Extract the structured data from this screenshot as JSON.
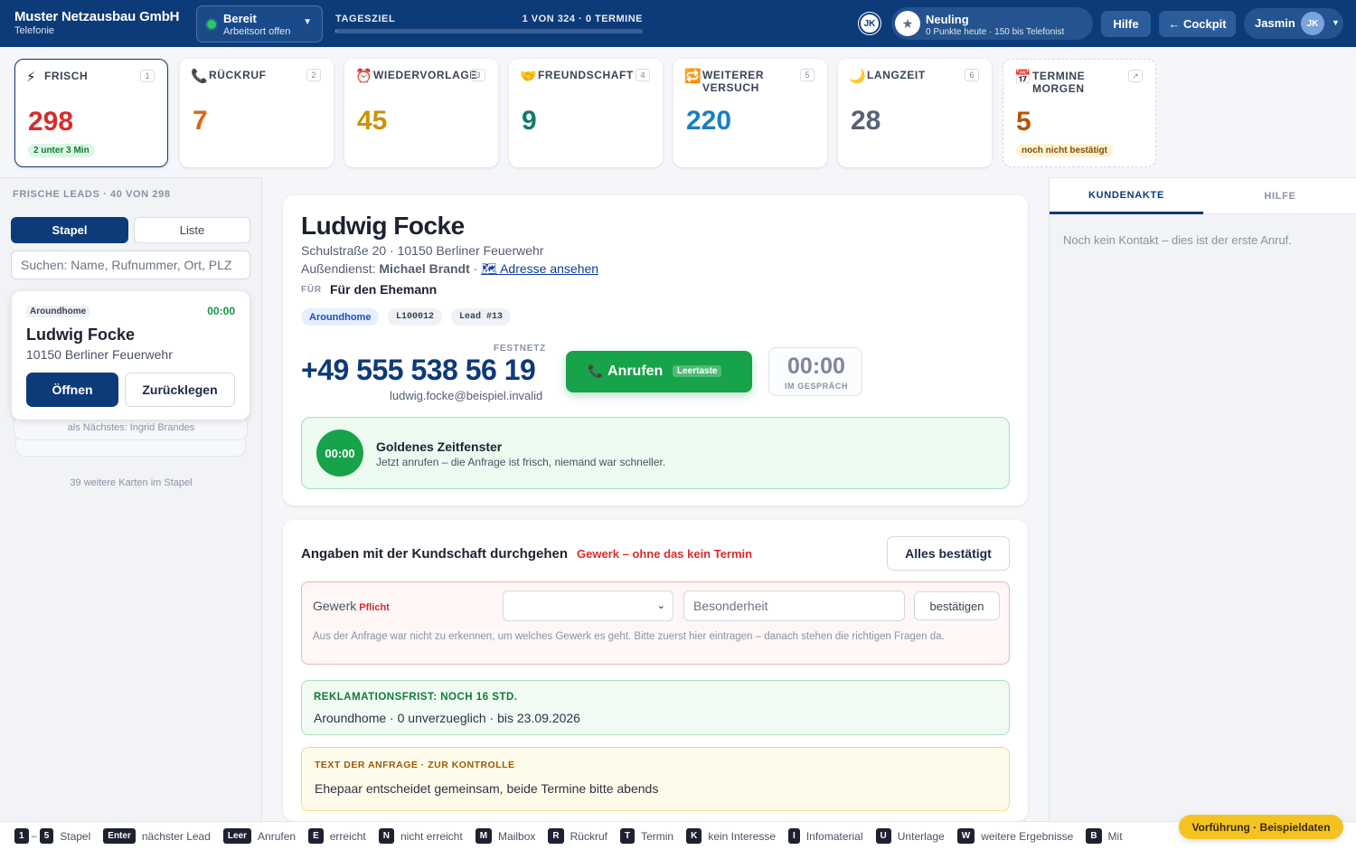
{
  "header": {
    "company": "Muster Netzausbau GmbH",
    "app": "Telefonie",
    "status": {
      "label": "Bereit",
      "sub": "Arbeitsort offen",
      "color": "#2ec46a"
    },
    "goal": {
      "label": "TAGESZIEL",
      "count": "1 VON 324 · 0 TERMINE",
      "progress": 0.003
    },
    "initials_badge": "JK",
    "level": {
      "name": "Neuling",
      "sub": "0 Punkte heute · 150 bis Telefonist"
    },
    "help_label": "Hilfe",
    "cockpit_label": "← Cockpit",
    "user": {
      "name": "Jasmin",
      "initials": "JK"
    }
  },
  "stacks": [
    {
      "icon": "lightning-icon",
      "glyph": "⚡",
      "title": "FRISCH",
      "key": "1",
      "count": "298",
      "color": "#d92c2c",
      "badge": "2 unter 3 Min"
    },
    {
      "icon": "phone-icon",
      "glyph": "📞",
      "title": "RÜCKRUF",
      "key": "2",
      "count": "7",
      "color": "#e0620e"
    },
    {
      "icon": "alarm-clock-icon",
      "glyph": "⏰",
      "title": "WIEDERVORLAGE",
      "key": "3",
      "count": "45",
      "color": "#c9920a"
    },
    {
      "icon": "handshake-icon",
      "glyph": "🤝",
      "title": "FREUNDSCHAFT",
      "key": "4",
      "count": "9",
      "color": "#137a6a"
    },
    {
      "icon": "repeat-icon",
      "glyph": "🔁",
      "title": "WEITERER VERSUCH",
      "key": "5",
      "count": "220",
      "color": "#1a7fc2"
    },
    {
      "icon": "moon-icon",
      "glyph": "🌙",
      "title": "LANGZEIT",
      "key": "6",
      "count": "28",
      "color": "#566275"
    },
    {
      "icon": "calendar-icon",
      "glyph": "📅",
      "title": "TERMINE MORGEN",
      "key": "↗",
      "count": "5",
      "color": "#b45309",
      "badge": "noch nicht bestätigt"
    }
  ],
  "left": {
    "header": "FRISCHE LEADS · 40 VON 298",
    "tab_stapel": "Stapel",
    "tab_liste": "Liste",
    "search_placeholder": "Suchen: Name, Rufnummer, Ort, PLZ",
    "card": {
      "source": "Aroundhome",
      "timer": "00:00",
      "name": "Ludwig Focke",
      "city": "10150 Berliner Feuerwehr",
      "open_label": "Öffnen",
      "back_label": "Zurücklegen"
    },
    "next_label": "als Nächstes: Ingrid Brandes",
    "more_label": "39 weitere Karten im Stapel"
  },
  "customer": {
    "name": "Ludwig Focke",
    "address": "Schulstraße 20 · 10150 Berliner Feuerwehr",
    "ad_prefix": "Außendienst: ",
    "ad_name": "Michael Brandt",
    "ad_sep": " · ",
    "address_link": "🗺 Adresse ansehen",
    "fuer_label": "FÜR",
    "fuer_value": "Für den Ehemann",
    "tags": [
      "Aroundhome",
      "L100012",
      "Lead #13"
    ],
    "phone_type": "FESTNETZ",
    "phone": "+49 555 538 56 19",
    "email": "ludwig.focke@beispiel.invalid",
    "call_label": "Anrufen",
    "call_key": "Leertaste",
    "call_timer": "00:00",
    "call_timer_label": "IM GESPRÄCH",
    "golden": {
      "timer": "00:00",
      "title": "Goldenes Zeitfenster",
      "text": "Jetzt anrufen – die Anfrage ist frisch, niemand war schneller."
    }
  },
  "details": {
    "title": "Angaben mit der Kundschaft durchgehen",
    "warning": "Gewerk – ohne das kein Termin",
    "confirm_all": "Alles bestätigt",
    "gewerk_label": "Gewerk",
    "gewerk_required": "Pflicht",
    "gewerk_selected": "",
    "special_placeholder": "Besonderheit",
    "confirm_label": "bestätigen",
    "gewerk_hint": "Aus der Anfrage war nicht zu erkennen, um welches Gewerk es geht. Bitte zuerst hier eintragen – danach stehen die richtigen Fragen da.",
    "complaint_title": "REKLAMATIONSFRIST: NOCH 16 STD.",
    "complaint_text": "Aroundhome · 0 unverzueglich · bis 23.09.2026",
    "request_title": "TEXT DER ANFRAGE · ZUR KONTROLLE",
    "request_text": "Ehepaar entscheidet gemeinsam, beide Termine bitte abends"
  },
  "right": {
    "tab_kundenakte": "KUNDENAKTE",
    "tab_hilfe": "HILFE",
    "empty_text": "Noch kein Kontakt – dies ist der erste Anruf."
  },
  "shortcuts": {
    "range_from": "1",
    "range_to": "5",
    "range_label": "Stapel",
    "items": [
      {
        "key": "Enter",
        "label": "nächster Lead"
      },
      {
        "key": "Leer",
        "label": "Anrufen"
      },
      {
        "key": "E",
        "label": "erreicht"
      },
      {
        "key": "N",
        "label": "nicht erreicht"
      },
      {
        "key": "M",
        "label": "Mailbox"
      },
      {
        "key": "R",
        "label": "Rückruf"
      },
      {
        "key": "T",
        "label": "Termin"
      },
      {
        "key": "K",
        "label": "kein Interesse"
      },
      {
        "key": "I",
        "label": "Infomaterial"
      },
      {
        "key": "U",
        "label": "Unterlage"
      },
      {
        "key": "W",
        "label": "weitere Ergebnisse"
      },
      {
        "key": "B",
        "label": "Mit"
      }
    ]
  },
  "demo_badge": "Vorführung · Beispieldaten"
}
